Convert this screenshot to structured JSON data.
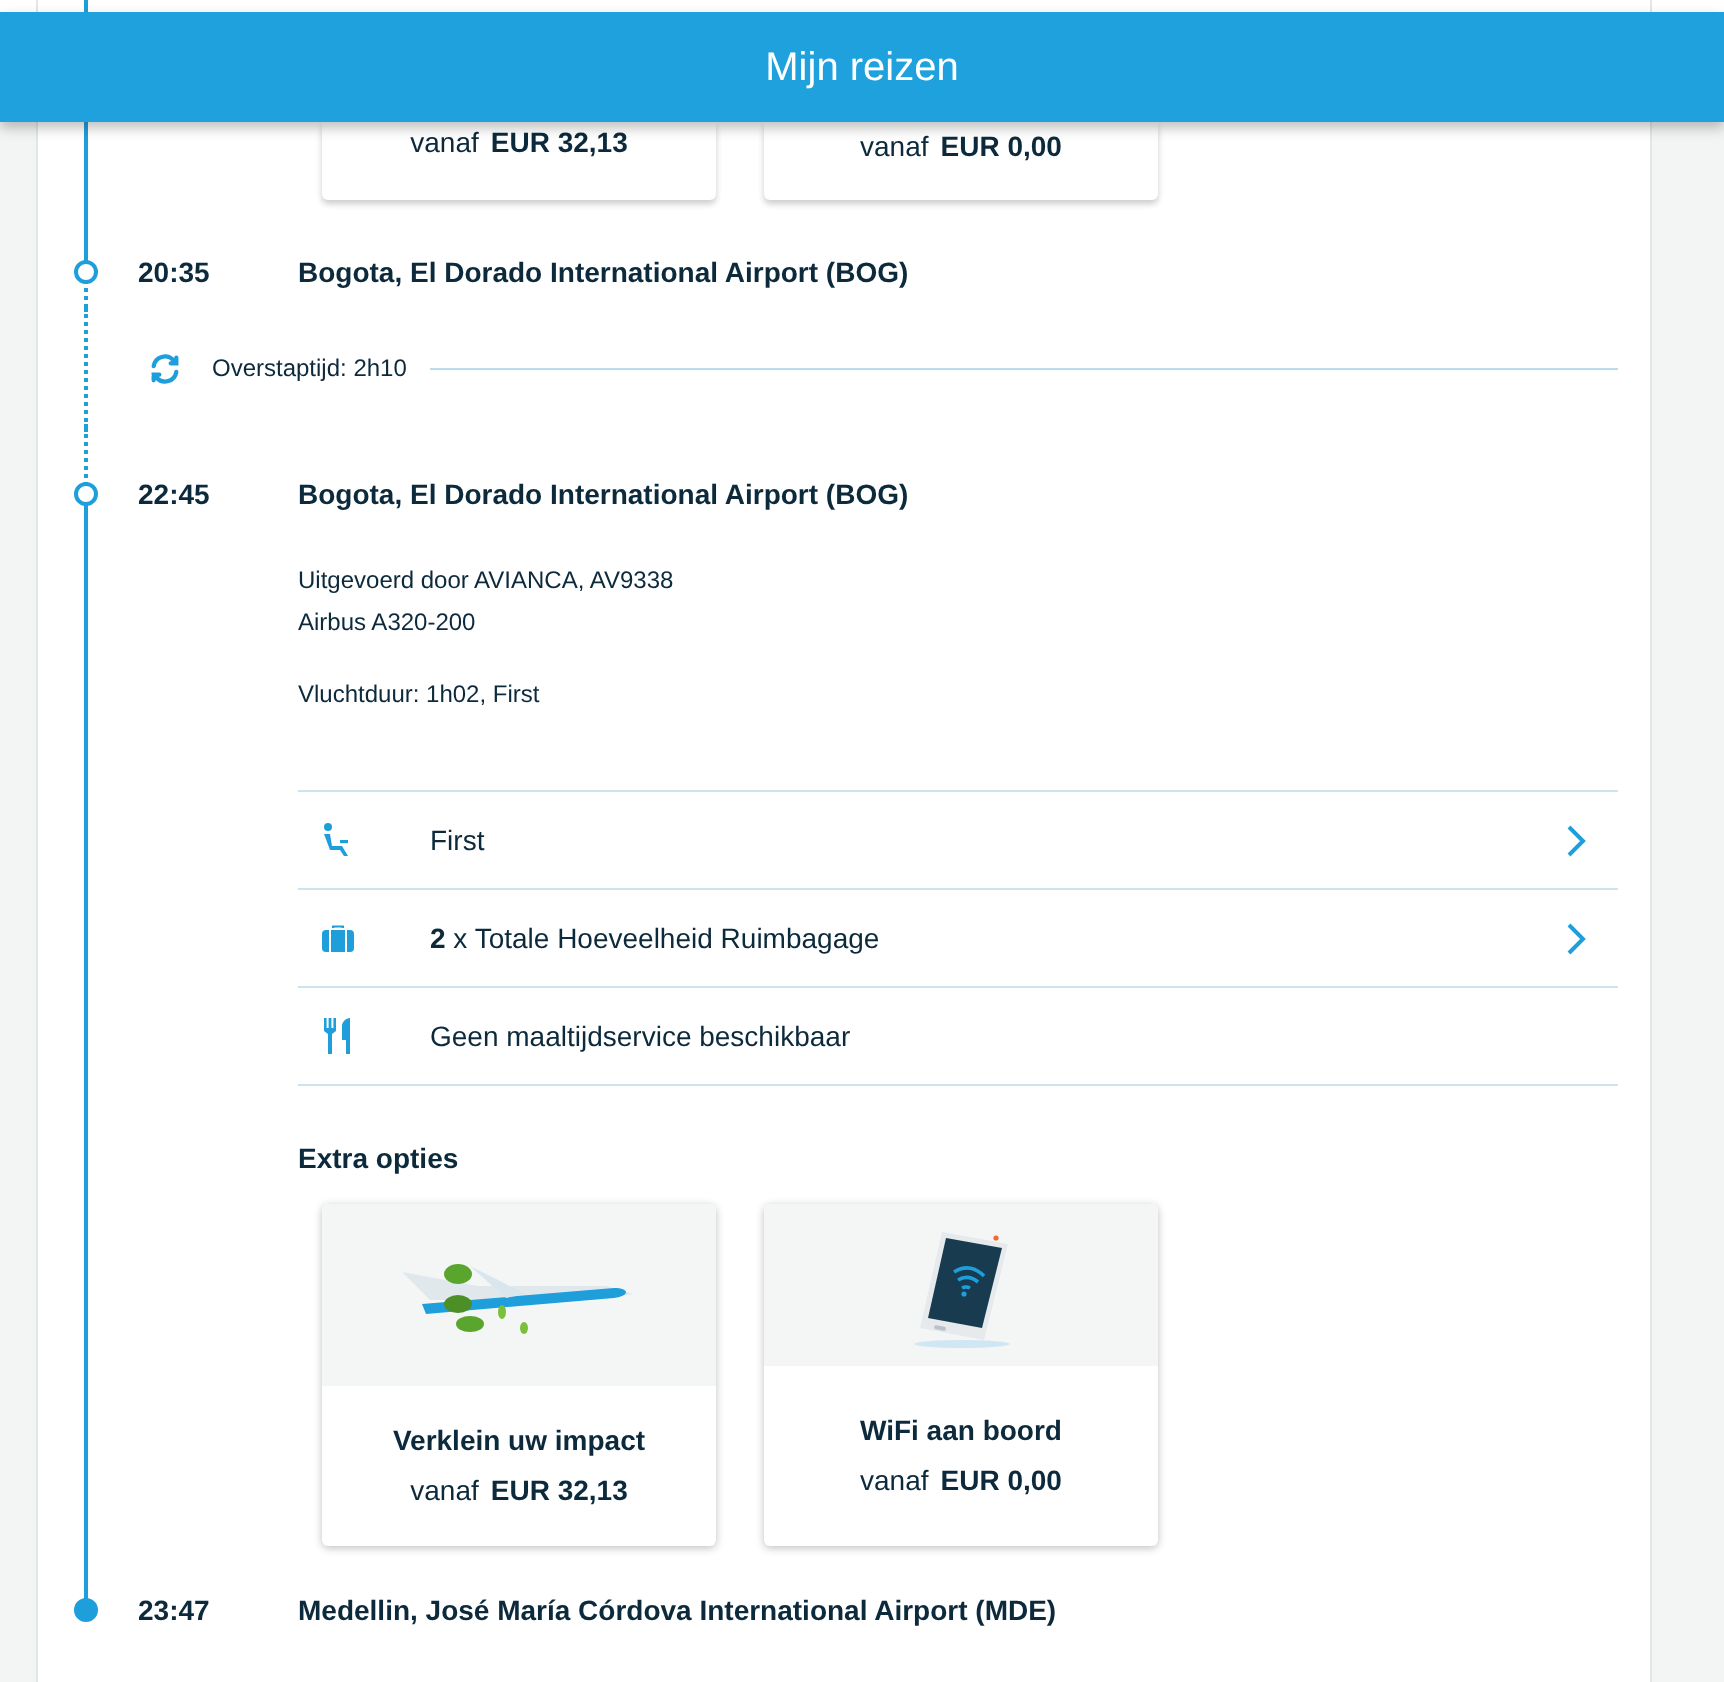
{
  "header": {
    "title": "Mijn reizen"
  },
  "timeline": [
    {
      "kind": "offers",
      "offers": [
        {
          "price_prefix": "vanaf",
          "price": "EUR 32,13"
        },
        {
          "price_prefix": "vanaf",
          "price": "EUR 0,00"
        }
      ]
    },
    {
      "kind": "stop",
      "time": "20:35",
      "place": "Bogota, El Dorado International Airport (BOG)",
      "final": false
    },
    {
      "kind": "transfer",
      "label": "Overstaptijd: 2h10"
    },
    {
      "kind": "stop",
      "time": "22:45",
      "place": "Bogota, El Dorado International Airport (BOG)",
      "final": false
    },
    {
      "kind": "flight",
      "operated_by": "Uitgevoerd door AVIANCA, AV9338",
      "aircraft": "Airbus A320-200",
      "duration": "Vluchtduur: 1h02, First",
      "services": [
        {
          "kind": "seat",
          "text": "First",
          "link": true
        },
        {
          "kind": "baggage",
          "text": "**2** x Totale Hoeveelheid Ruimbagage",
          "link": true
        },
        {
          "kind": "meal",
          "text": "Geen maaltijdservice beschikbaar",
          "link": false
        }
      ],
      "extras_title": "Extra opties",
      "extras": [
        {
          "kind": "impact",
          "title": "Verklein uw impact",
          "price_prefix": "vanaf",
          "price": "EUR 32,13"
        },
        {
          "kind": "wifi",
          "title": "WiFi aan boord",
          "price_prefix": "vanaf",
          "price": "EUR 0,00"
        }
      ]
    },
    {
      "kind": "stop",
      "time": "23:47",
      "place": "Medellin, José María Córdova International Airport (MDE)",
      "final": true
    }
  ]
}
